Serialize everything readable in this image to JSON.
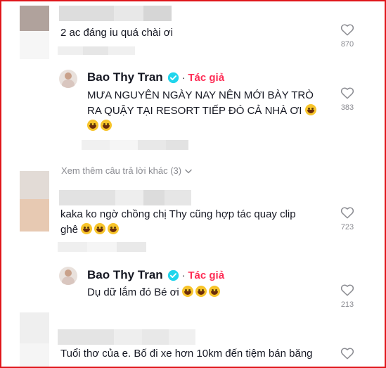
{
  "comments": [
    {
      "text": "2 ac đáng iu quá chài ơi",
      "likes": "870"
    },
    {
      "author": "Bao Thy Tran",
      "author_tag": "Tác giả",
      "separator": "·",
      "text_line1": "MƯA NGUYÊN NGÀY NAY NÊN MỚI BÀY TRÒ",
      "text_line2": "RA QUẬY TẠI RESORT TIẾP ĐÓ CẢ NHÀ ƠI",
      "likes": "383"
    },
    {
      "text_line1": "kaka ko ngờ chồng chị Thy cũng hợp tác quay clip",
      "text_line2": "ghê",
      "likes": "723"
    },
    {
      "author": "Bao Thy Tran",
      "author_tag": "Tác giả",
      "separator": "·",
      "text": "Dụ dữ lắm đó Bé ơi",
      "likes": "213"
    },
    {
      "text": "Tuổi thơ của e. Bố đi xe hơn 10km đến tiệm bán băng"
    }
  ],
  "more_replies": "Xem thêm câu trả lời khác (3)",
  "icons": {
    "like": "heart-outline-icon",
    "verified": "verified-badge-icon",
    "expand": "chevron-down-icon"
  },
  "colors": {
    "border": "#e0161b",
    "author_tag": "#fe2c55",
    "verified": "#20d5ec",
    "muted": "#8a8b91"
  }
}
